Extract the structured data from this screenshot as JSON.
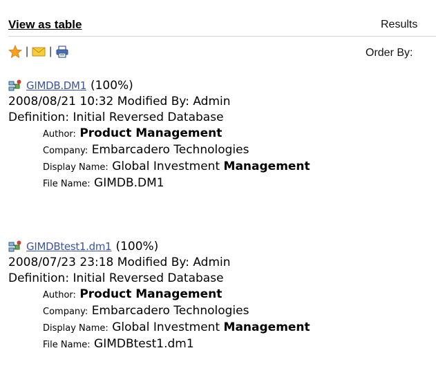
{
  "header": {
    "view_as_table": "View as table",
    "results_label": "Results",
    "order_by_label": "Order By:"
  },
  "toolbar": {
    "separator": "|",
    "icons": [
      "star-icon",
      "mail-icon",
      "print-icon"
    ]
  },
  "results": [
    {
      "link_text": "GIMDB.DM1",
      "percent": "(100%)",
      "modified_line": "2008/08/21 10:32 Modified By: Admin",
      "definition_line": "Definition: Initial Reversed Database",
      "author_label": "Author:",
      "author_value": "Product Management",
      "company_label": "Company:",
      "company_value": "Embarcadero Technologies",
      "display_label": "Display Name:",
      "display_value_a": "Global Investment",
      "display_value_b": "Management",
      "file_label": "File Name:",
      "file_value": "GIMDB.DM1"
    },
    {
      "link_text": "GIMDBtest1.dm1",
      "percent": "(100%)",
      "modified_line": "2008/07/23 23:18 Modified By: Admin",
      "definition_line": "Definition: Initial Reversed Database",
      "author_label": "Author:",
      "author_value": "Product Management",
      "company_label": "Company:",
      "company_value": "Embarcadero Technologies",
      "display_label": "Display Name:",
      "display_value_a": "Global Investment",
      "display_value_b": "Management",
      "file_label": "File Name:",
      "file_value": "GIMDBtest1.dm1"
    }
  ]
}
